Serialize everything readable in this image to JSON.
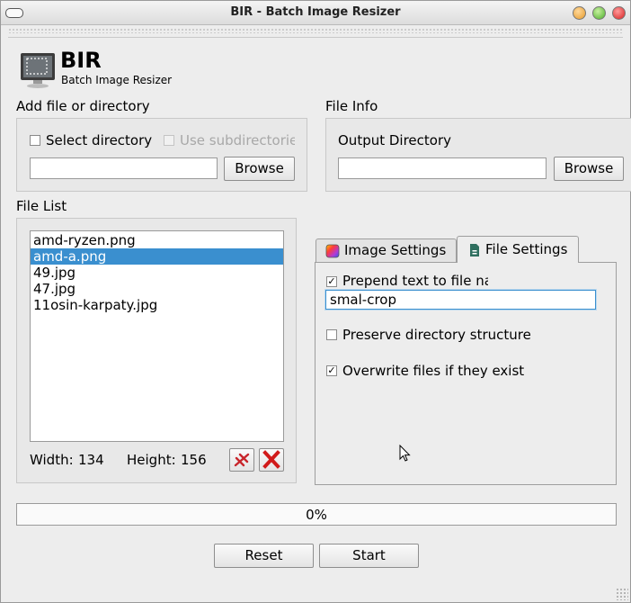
{
  "window": {
    "title": "BIR - Batch Image Resizer"
  },
  "header": {
    "app_name": "BIR",
    "app_subtitle": "Batch Image Resizer"
  },
  "add_file": {
    "group_title": "Add file or directory",
    "select_directory_label": "Select directory",
    "use_subdirectories_label": "Use subdirectorie",
    "path_value": "",
    "browse_label": "Browse"
  },
  "file_info": {
    "group_title": "File Info",
    "output_directory_label": "Output Directory",
    "output_value": "",
    "browse_label": "Browse"
  },
  "file_list": {
    "group_title": "File List",
    "items": [
      "amd-ryzen.png",
      "amd-a.png",
      "49.jpg",
      "47.jpg",
      "11osin-karpaty.jpg"
    ],
    "selected_index": 1,
    "width_label": "Width:",
    "width_value": "134",
    "height_label": "Height:",
    "height_value": "156"
  },
  "tabs": {
    "image_settings": "Image Settings",
    "file_settings": "File Settings",
    "active": "file_settings"
  },
  "file_settings": {
    "prepend_label": "Prepend text to file na",
    "prepend_checked": true,
    "prepend_value": "smal-crop",
    "preserve_label": "Preserve directory structure",
    "preserve_checked": false,
    "overwrite_label": "Overwrite files if they exist",
    "overwrite_checked": true
  },
  "progress": {
    "value": 0,
    "text": "0%"
  },
  "footer": {
    "reset_label": "Reset",
    "start_label": "Start"
  },
  "colors": {
    "selection": "#3a8fcf",
    "close_red": "#d62020",
    "accent_green": "#4caf2a",
    "accent_orange": "#f0a030"
  }
}
